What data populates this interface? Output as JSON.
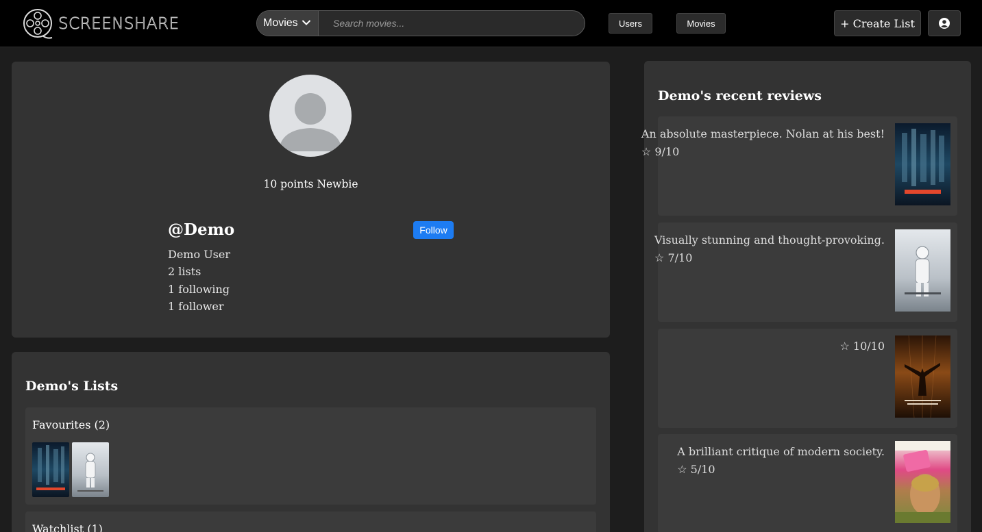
{
  "brand": {
    "name": "SCREENSHARE"
  },
  "search": {
    "category": "Movies",
    "placeholder": "Search movies..."
  },
  "nav": {
    "users_label": "Users",
    "movies_label": "Movies",
    "create_list_label": "+ Create List"
  },
  "profile": {
    "points_text": "10 points Newbie",
    "username": "@Demo",
    "follow_label": "Follow",
    "display_name": "Demo User",
    "lists_count": "2 lists",
    "following_count": "1 following",
    "followers_count": "1 follower"
  },
  "lists": {
    "title": "Demo's Lists",
    "items": [
      {
        "title": "Favourites (2)",
        "posters": [
          "inception-poster",
          "interstellar-poster"
        ]
      },
      {
        "title": "Watchlist (1)"
      }
    ]
  },
  "reviews": {
    "title": "Demo's recent reviews",
    "items": [
      {
        "text": "An absolute masterpiece. Nolan at his best!",
        "rating": "☆ 9/10",
        "poster": "inception-poster"
      },
      {
        "text": "Visually stunning and thought-provoking.",
        "rating": "☆ 7/10",
        "poster": "interstellar-poster"
      },
      {
        "text": "",
        "rating": "☆ 10/10",
        "poster": "shawshank-poster"
      },
      {
        "text": "A brilliant critique of modern society.",
        "rating": "☆ 5/10",
        "poster": "fight-club-poster"
      }
    ]
  },
  "colors": {
    "background": "#1d1d1d",
    "card": "#333333",
    "follow_button": "#1d7cf2"
  }
}
